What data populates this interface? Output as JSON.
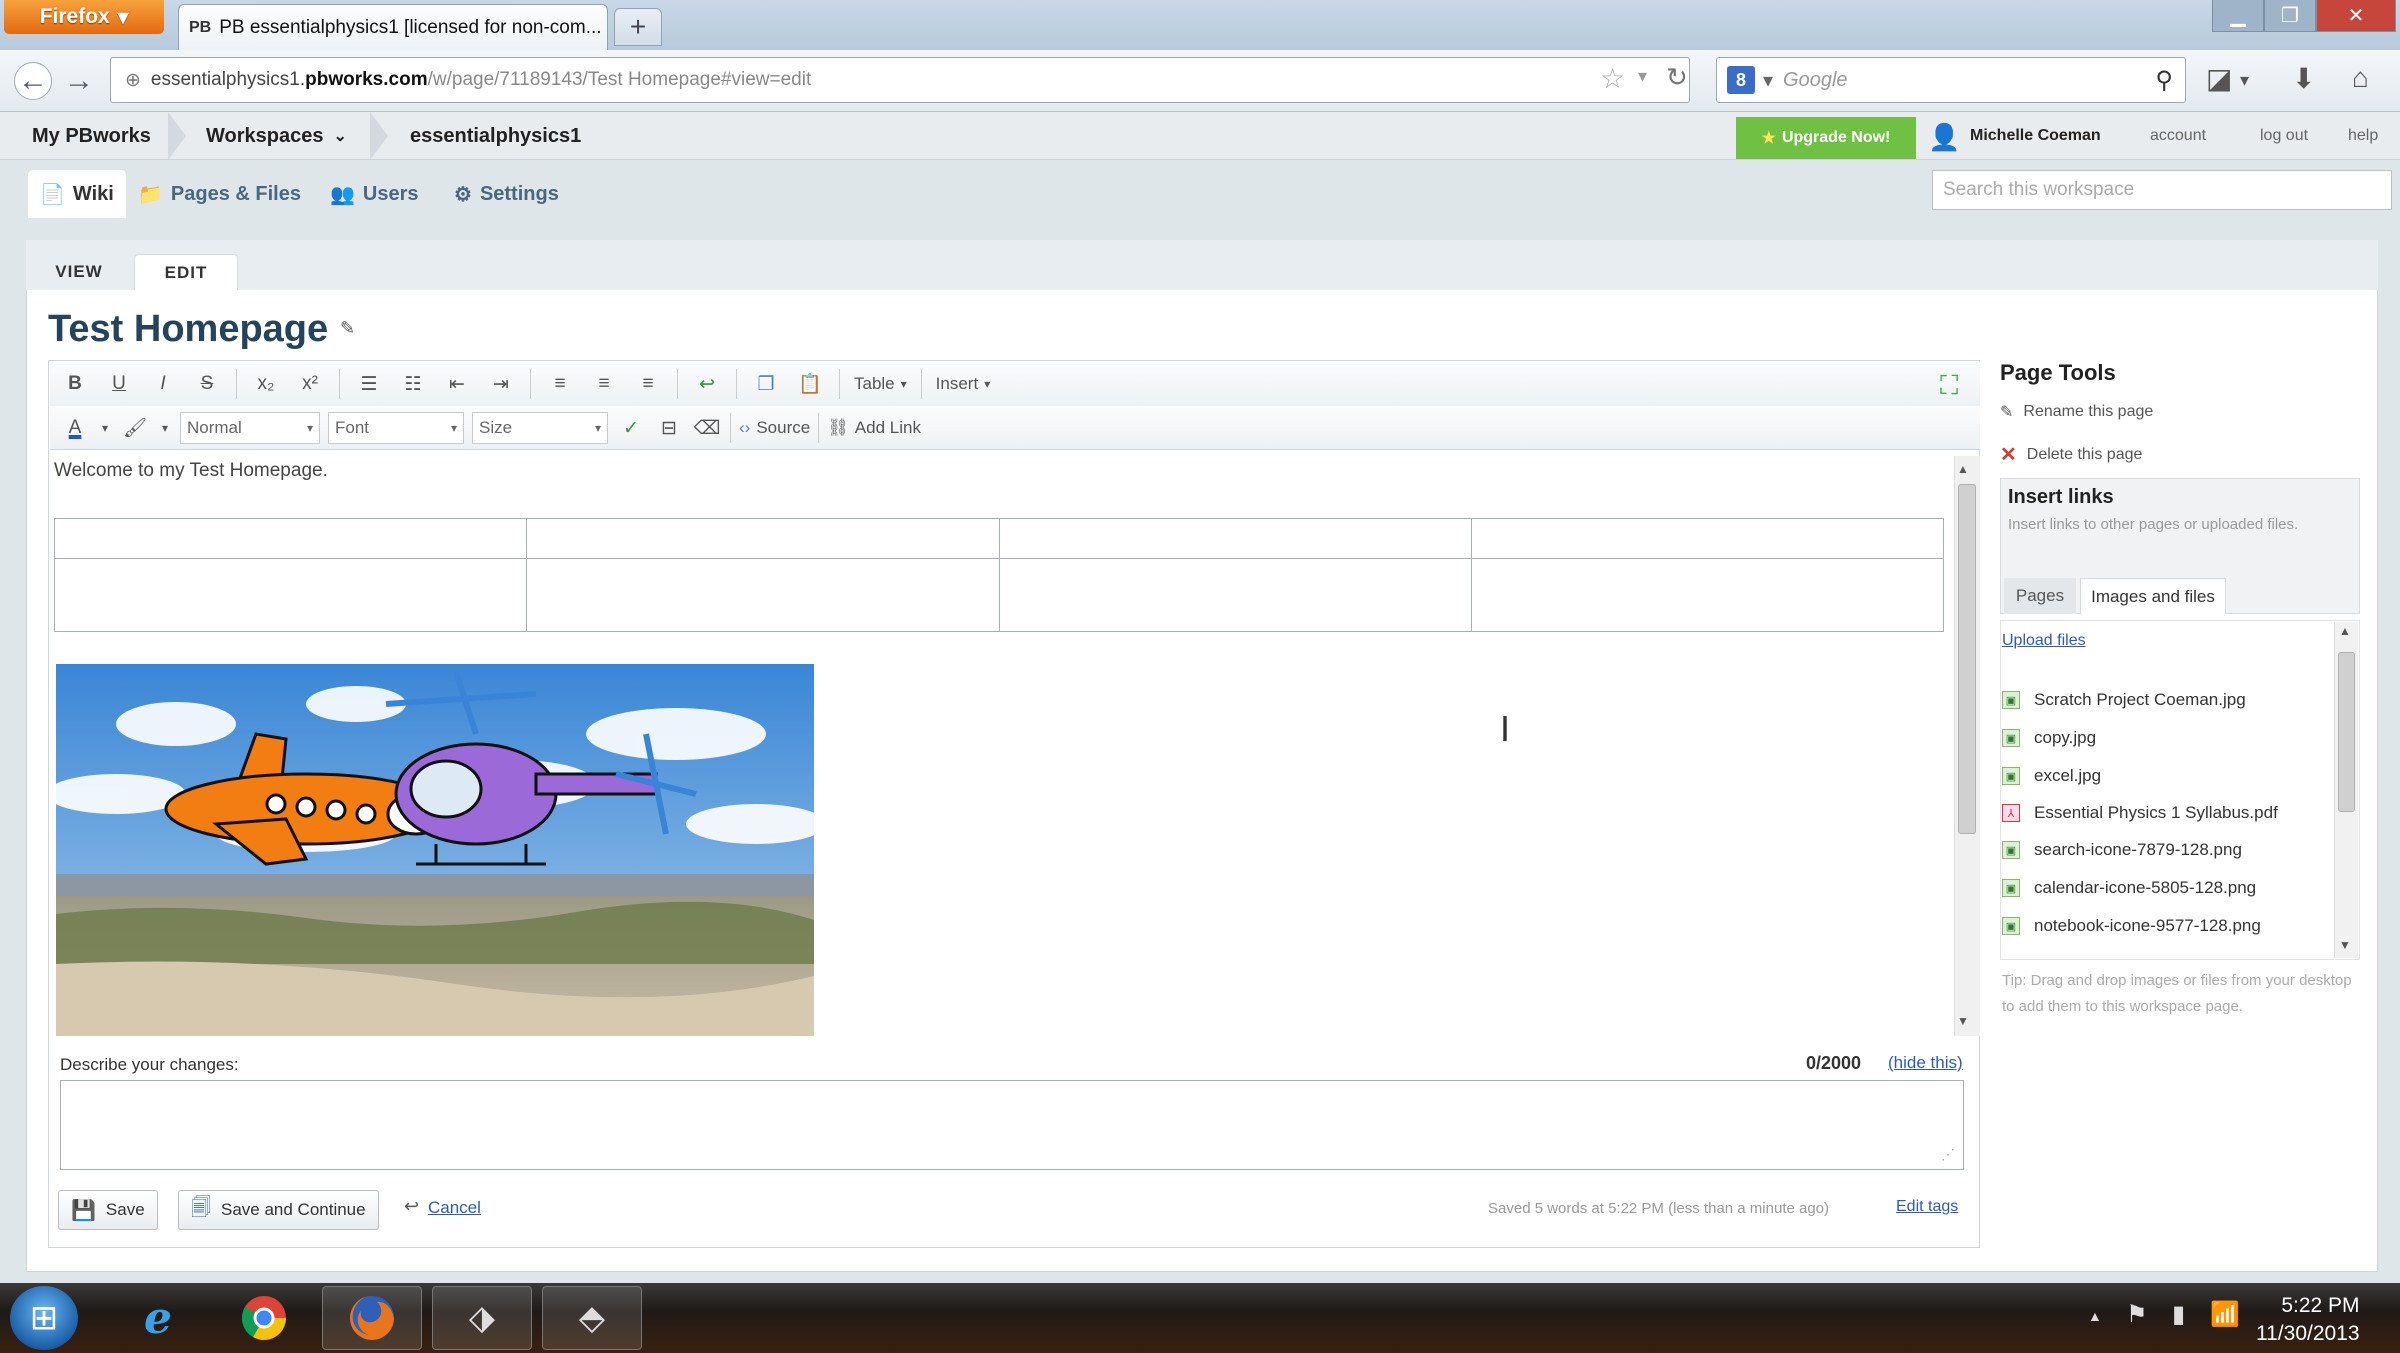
{
  "browser": {
    "app_button": "Firefox",
    "tab_title": "PB essentialphysics1 [licensed for non-com...",
    "tab_favicon": "PB",
    "url_prefix": "essentialphysics1.",
    "url_domain": "pbworks.com",
    "url_path": "/w/page/71189143/Test Homepage#view=edit",
    "search_placeholder": "Google",
    "search_engine_badge": "8"
  },
  "pb": {
    "nav": {
      "my_pbworks": "My PBworks",
      "workspaces": "Workspaces",
      "workspace_name": "essentialphysics1"
    },
    "upgrade": "Upgrade Now!",
    "user": "Michelle Coeman",
    "links": {
      "account": "account",
      "logout": "log out",
      "help": "help"
    },
    "tabs": [
      {
        "label": "Wiki"
      },
      {
        "label": "Pages & Files"
      },
      {
        "label": "Users"
      },
      {
        "label": "Settings"
      }
    ],
    "search_placeholder": "Search this workspace"
  },
  "page": {
    "view_tab": "VIEW",
    "edit_tab": "EDIT",
    "title": "Test Homepage"
  },
  "editor": {
    "format_select": "Normal",
    "font_select": "Font",
    "size_select": "Size",
    "table_menu": "Table",
    "insert_menu": "Insert",
    "source": "Source",
    "add_link": "Add Link",
    "welcome_text": "Welcome to my Test Homepage.",
    "describe_label": "Describe your changes:",
    "char_counter": "0/2000",
    "hide_this": "(hide this)",
    "save": "Save",
    "save_continue": "Save and Continue",
    "cancel": "Cancel",
    "saved_status": "Saved 5 words at 5:22 PM (less than a minute ago)",
    "edit_tags": "Edit tags"
  },
  "page_tools": {
    "title": "Page Tools",
    "rename": "Rename this page",
    "delete": "Delete this page",
    "insert_links_title": "Insert links",
    "insert_links_desc": "Insert links to other pages or uploaded files.",
    "tab_pages": "Pages",
    "tab_images": "Images and files",
    "upload": "Upload files",
    "files": [
      {
        "name": "Scratch Project Coeman.jpg",
        "icon": "image-file-icon"
      },
      {
        "name": "copy.jpg",
        "icon": "image-file-icon"
      },
      {
        "name": "excel.jpg",
        "icon": "image-file-icon"
      },
      {
        "name": "Essential Physics 1 Syllabus.pdf",
        "icon": "pdf-file-icon"
      },
      {
        "name": "search-icone-7879-128.png",
        "icon": "image-file-icon"
      },
      {
        "name": "calendar-icone-5805-128.png",
        "icon": "image-file-icon"
      },
      {
        "name": "notebook-icone-9577-128.png",
        "icon": "image-file-icon"
      }
    ],
    "tip": "Tip: Drag and drop images or files from your desktop to add them to this workspace page."
  },
  "taskbar": {
    "time": "5:22 PM",
    "date": "11/30/2013"
  },
  "colors": {
    "upgrade_green": "#6fc043",
    "link_blue": "#2a5db0",
    "title_navy": "#24445c",
    "firefox_orange": "#e26a12"
  }
}
